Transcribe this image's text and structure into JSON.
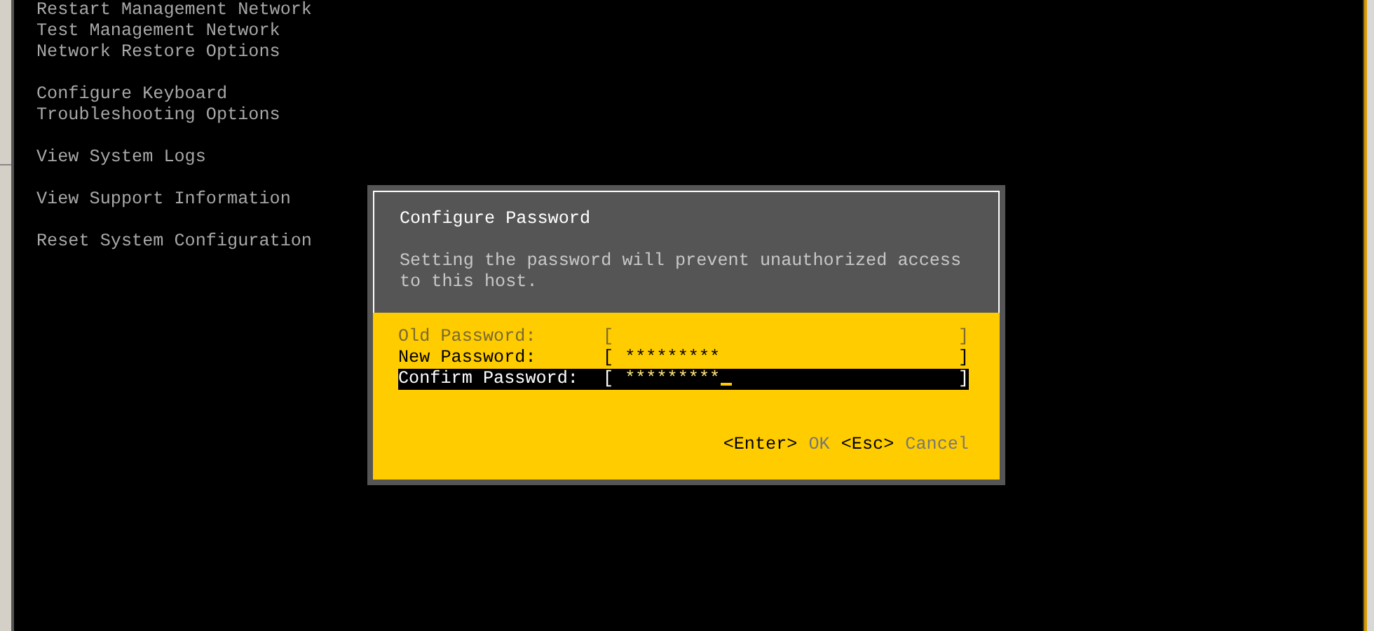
{
  "menu": {
    "groups": [
      [
        "Restart Management Network",
        "Test Management Network",
        "Network Restore Options"
      ],
      [
        "Configure Keyboard",
        "Troubleshooting Options"
      ],
      [
        "View System Logs"
      ],
      [
        "View Support Information"
      ],
      [
        "Reset System Configuration"
      ]
    ]
  },
  "dialog": {
    "title": "Configure Password",
    "description": "Setting the password will prevent unauthorized access to this host.",
    "fields": [
      {
        "label": "Old Password:",
        "disabled": true,
        "selected": false,
        "cursor": false
      },
      {
        "label": "New Password:",
        "value": "*********",
        "disabled": false,
        "selected": false,
        "cursor": false
      },
      {
        "label": "Confirm Password:",
        "value": "*********",
        "disabled": false,
        "selected": true,
        "cursor": true
      }
    ],
    "open_bracket": "[",
    "close_bracket": "]",
    "actions": [
      {
        "key": "<Enter>",
        "label": "OK"
      },
      {
        "key": "<Esc>",
        "label": "Cancel"
      }
    ]
  }
}
